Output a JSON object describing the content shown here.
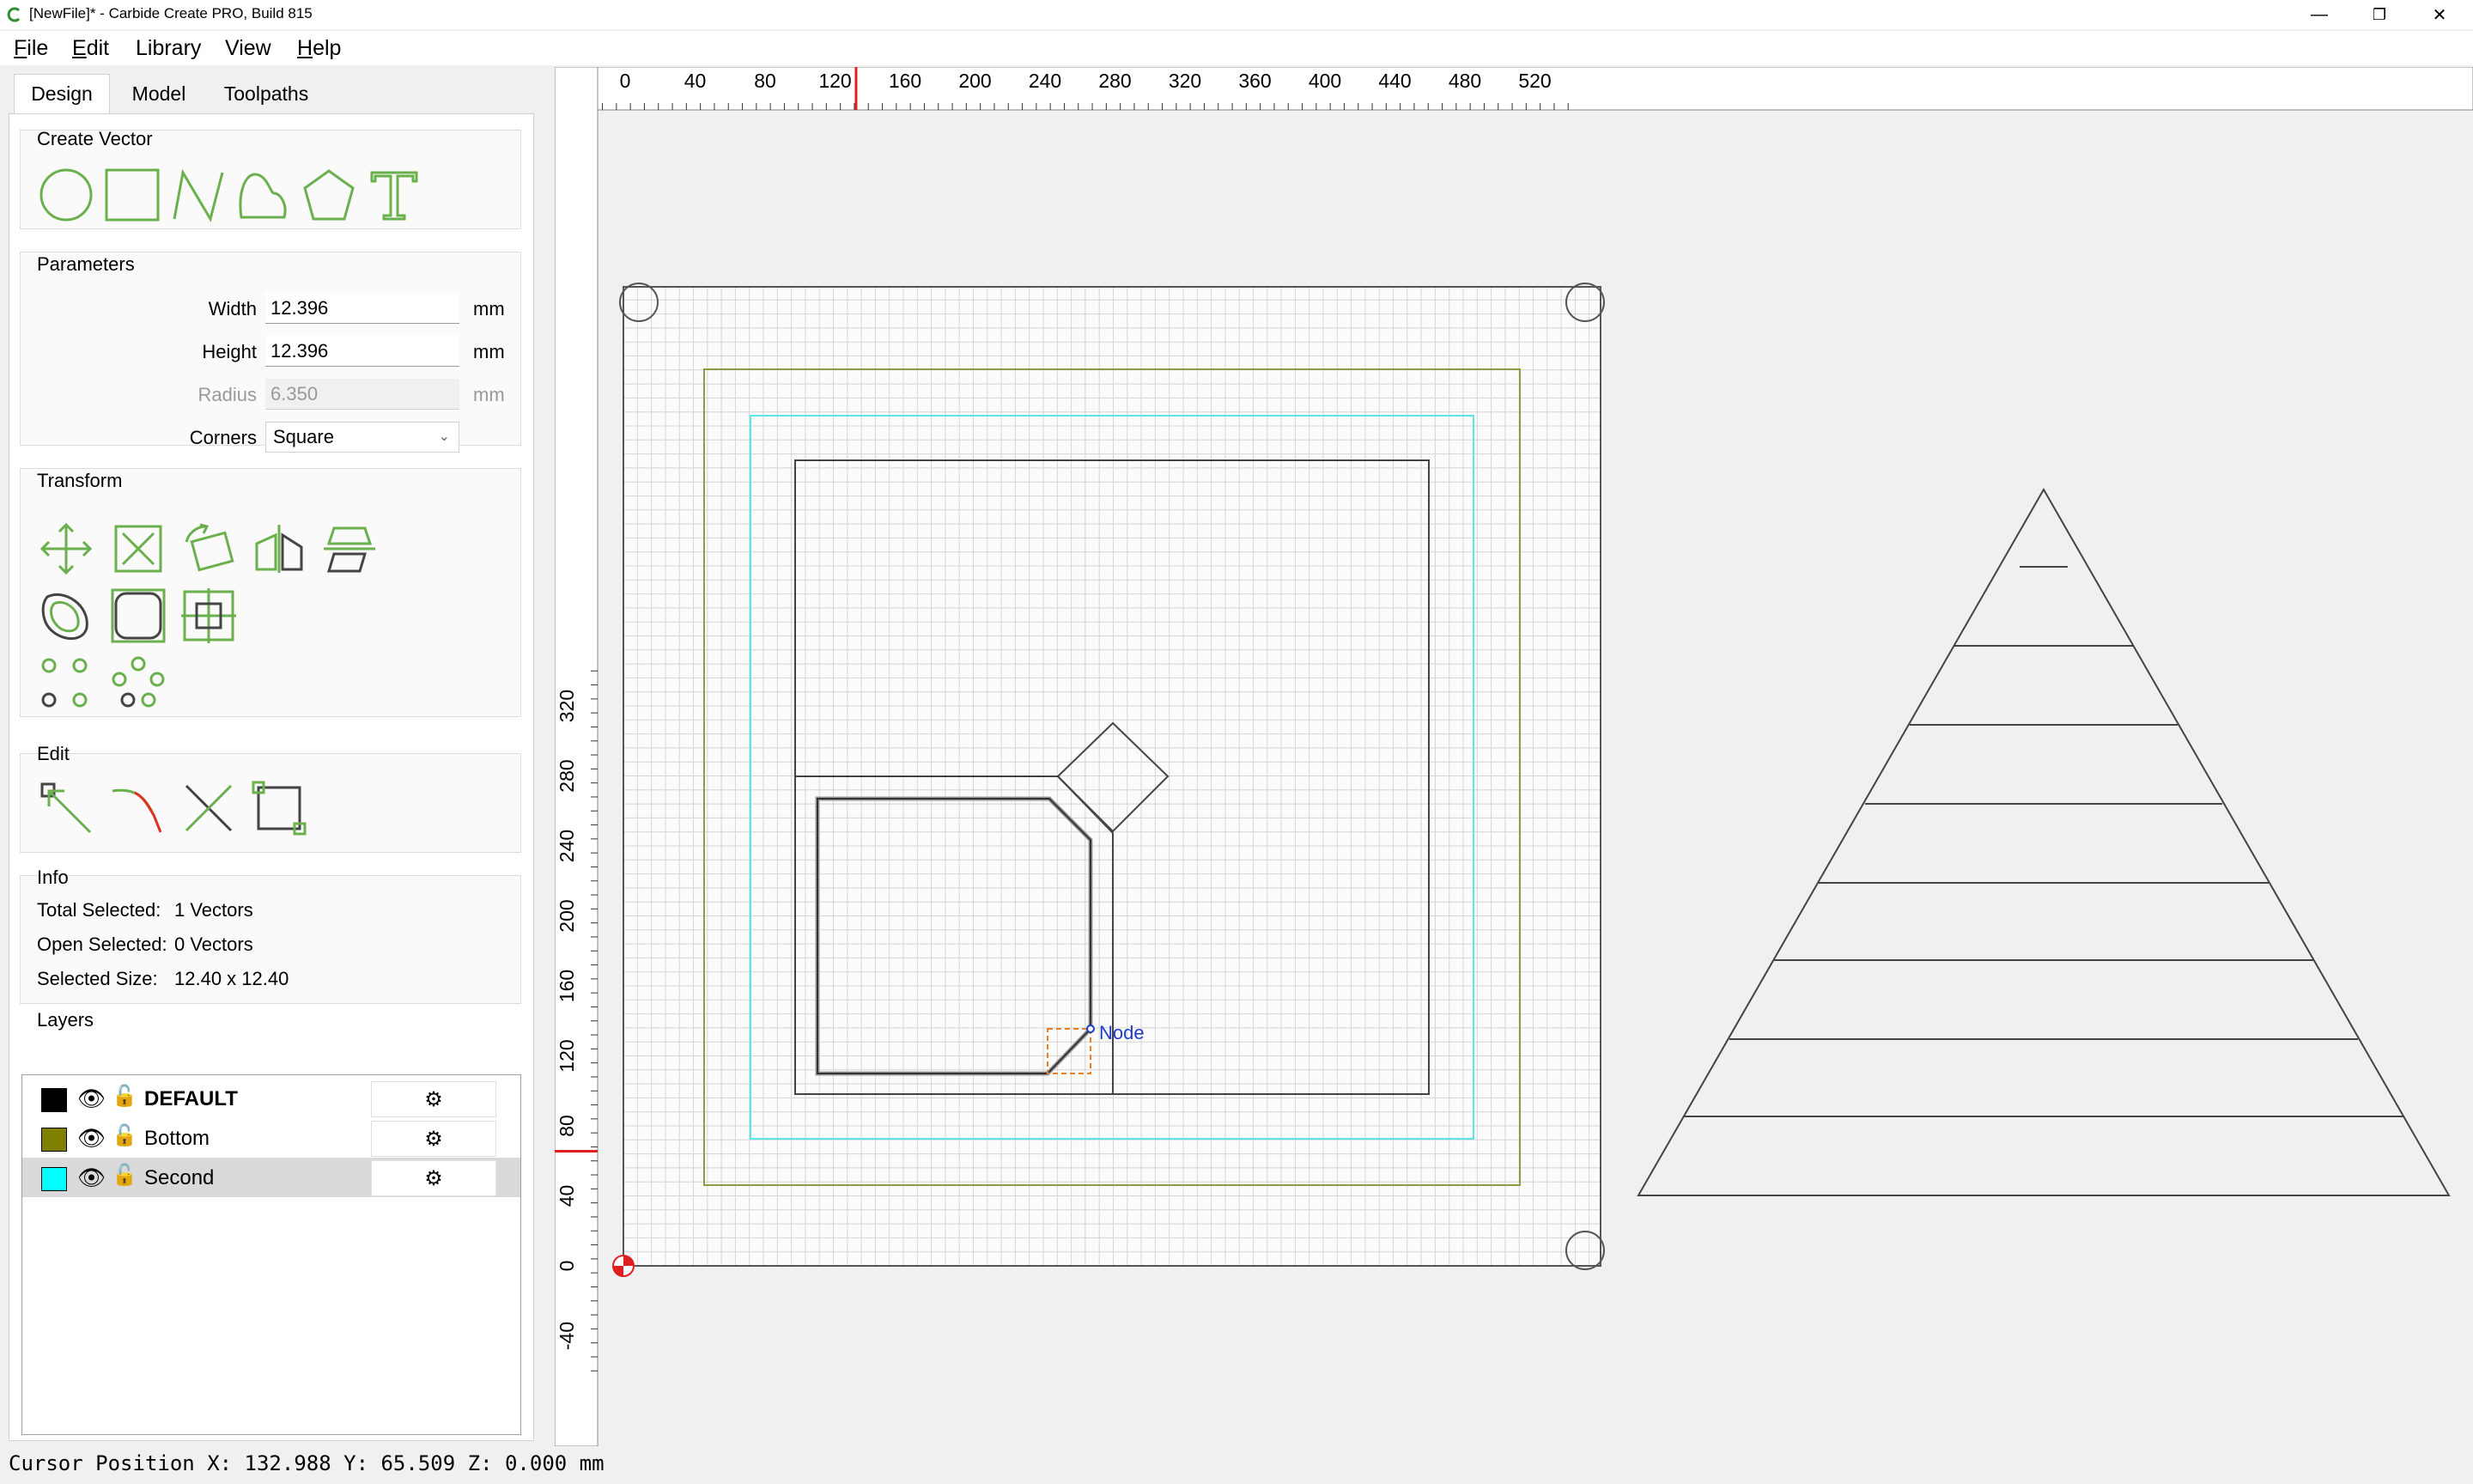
{
  "window": {
    "title": "[NewFile]* - Carbide Create PRO, Build 815",
    "controls": {
      "minimize": "—",
      "maximize": "❐",
      "close": "✕"
    }
  },
  "menu": {
    "file": {
      "u": "F",
      "rest": "ile"
    },
    "edit": {
      "u": "E",
      "rest": "dit"
    },
    "library": {
      "u": "",
      "rest": "Library"
    },
    "view": {
      "u": "",
      "rest": "View"
    },
    "help": {
      "u": "H",
      "rest": "elp"
    }
  },
  "tabs": [
    "Design",
    "Model",
    "Toolpaths"
  ],
  "create_vector": {
    "title": "Create Vector",
    "icons": [
      "circle-icon",
      "rectangle-icon",
      "polyline-icon",
      "curve-icon",
      "polygon-icon",
      "text-icon"
    ]
  },
  "parameters": {
    "title": "Parameters",
    "width_label": "Width",
    "width_value": "12.396",
    "height_label": "Height",
    "height_value": "12.396",
    "radius_label": "Radius",
    "radius_value": "6.350",
    "corners_label": "Corners",
    "corners_value": "Square",
    "unit": "mm"
  },
  "transform": {
    "title": "Transform"
  },
  "edit": {
    "title": "Edit"
  },
  "info": {
    "title": "Info",
    "total_selected_label": "Total Selected:",
    "total_selected_value": "1 Vectors",
    "open_selected_label": "Open Selected:",
    "open_selected_value": "0 Vectors",
    "selected_size_label": "Selected Size:",
    "selected_size_value": "12.40 x 12.40"
  },
  "layers": {
    "title": "Layers",
    "items": [
      {
        "name": "DEFAULT",
        "color": "#000000",
        "bold": true
      },
      {
        "name": "Bottom",
        "color": "#808000",
        "bold": false
      },
      {
        "name": "Second",
        "color": "#00ffff",
        "bold": false,
        "selected": true
      }
    ]
  },
  "ruler": {
    "x_ticks": [
      "0",
      "40",
      "80",
      "120",
      "160",
      "200",
      "240",
      "280",
      "320",
      "360",
      "400",
      "440",
      "480",
      "520"
    ],
    "y_ticks": [
      "320",
      "280",
      "240",
      "200",
      "160",
      "120",
      "80",
      "40",
      "0",
      "-40"
    ],
    "cursor_x": 132.988,
    "cursor_y": 65.509
  },
  "canvas": {
    "node_label": "Node",
    "colors": {
      "bottom_layer": "#8e9a45",
      "second_layer": "#5ce6e6",
      "selection": "#e8802a",
      "node_label": "#1f3cc8",
      "origin": "#e02020"
    }
  },
  "status": {
    "cursor_position": "Cursor Position X: 132.988 Y: 65.509 Z: 0.000 mm"
  },
  "accent": "#6ab04c"
}
